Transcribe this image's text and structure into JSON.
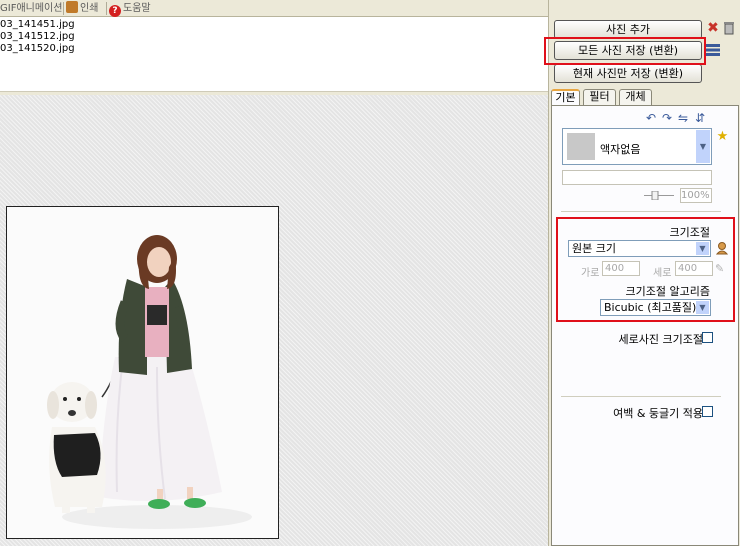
{
  "top_tabs": {
    "gif": "GIF애니메이션",
    "print": "인쇄",
    "help": "도움말",
    "help_glyph": "?"
  },
  "files": [
    "03_141451.jpg",
    "03_141512.jpg",
    "03_141520.jpg"
  ],
  "buttons": {
    "add_photo": "사진 추가",
    "save_all": "모든 사진 저장 (변환)",
    "save_current": "현재 사진만 저장 (변환)"
  },
  "tabs": {
    "basic": "기본",
    "filter": "필터",
    "object": "개체"
  },
  "frame": {
    "label": "액자없음"
  },
  "opacity": {
    "percent": "100%"
  },
  "resize": {
    "label": "크기조절",
    "mode": "원본 크기",
    "width_label": "가로",
    "width_value": "400",
    "height_label": "세로",
    "height_value": "400",
    "algo_label": "크기조절 알고리즘",
    "algo_value": "Bicubic (최고품질)"
  },
  "options": {
    "vertical_resize": "세로사진 크기조절",
    "margin_round": "여백 & 둥글기 적용"
  },
  "colors": {
    "highlight": "#e0101a",
    "panel_bg": "#ece9d8",
    "combo_arrow_bg": "#c1d3fb"
  }
}
